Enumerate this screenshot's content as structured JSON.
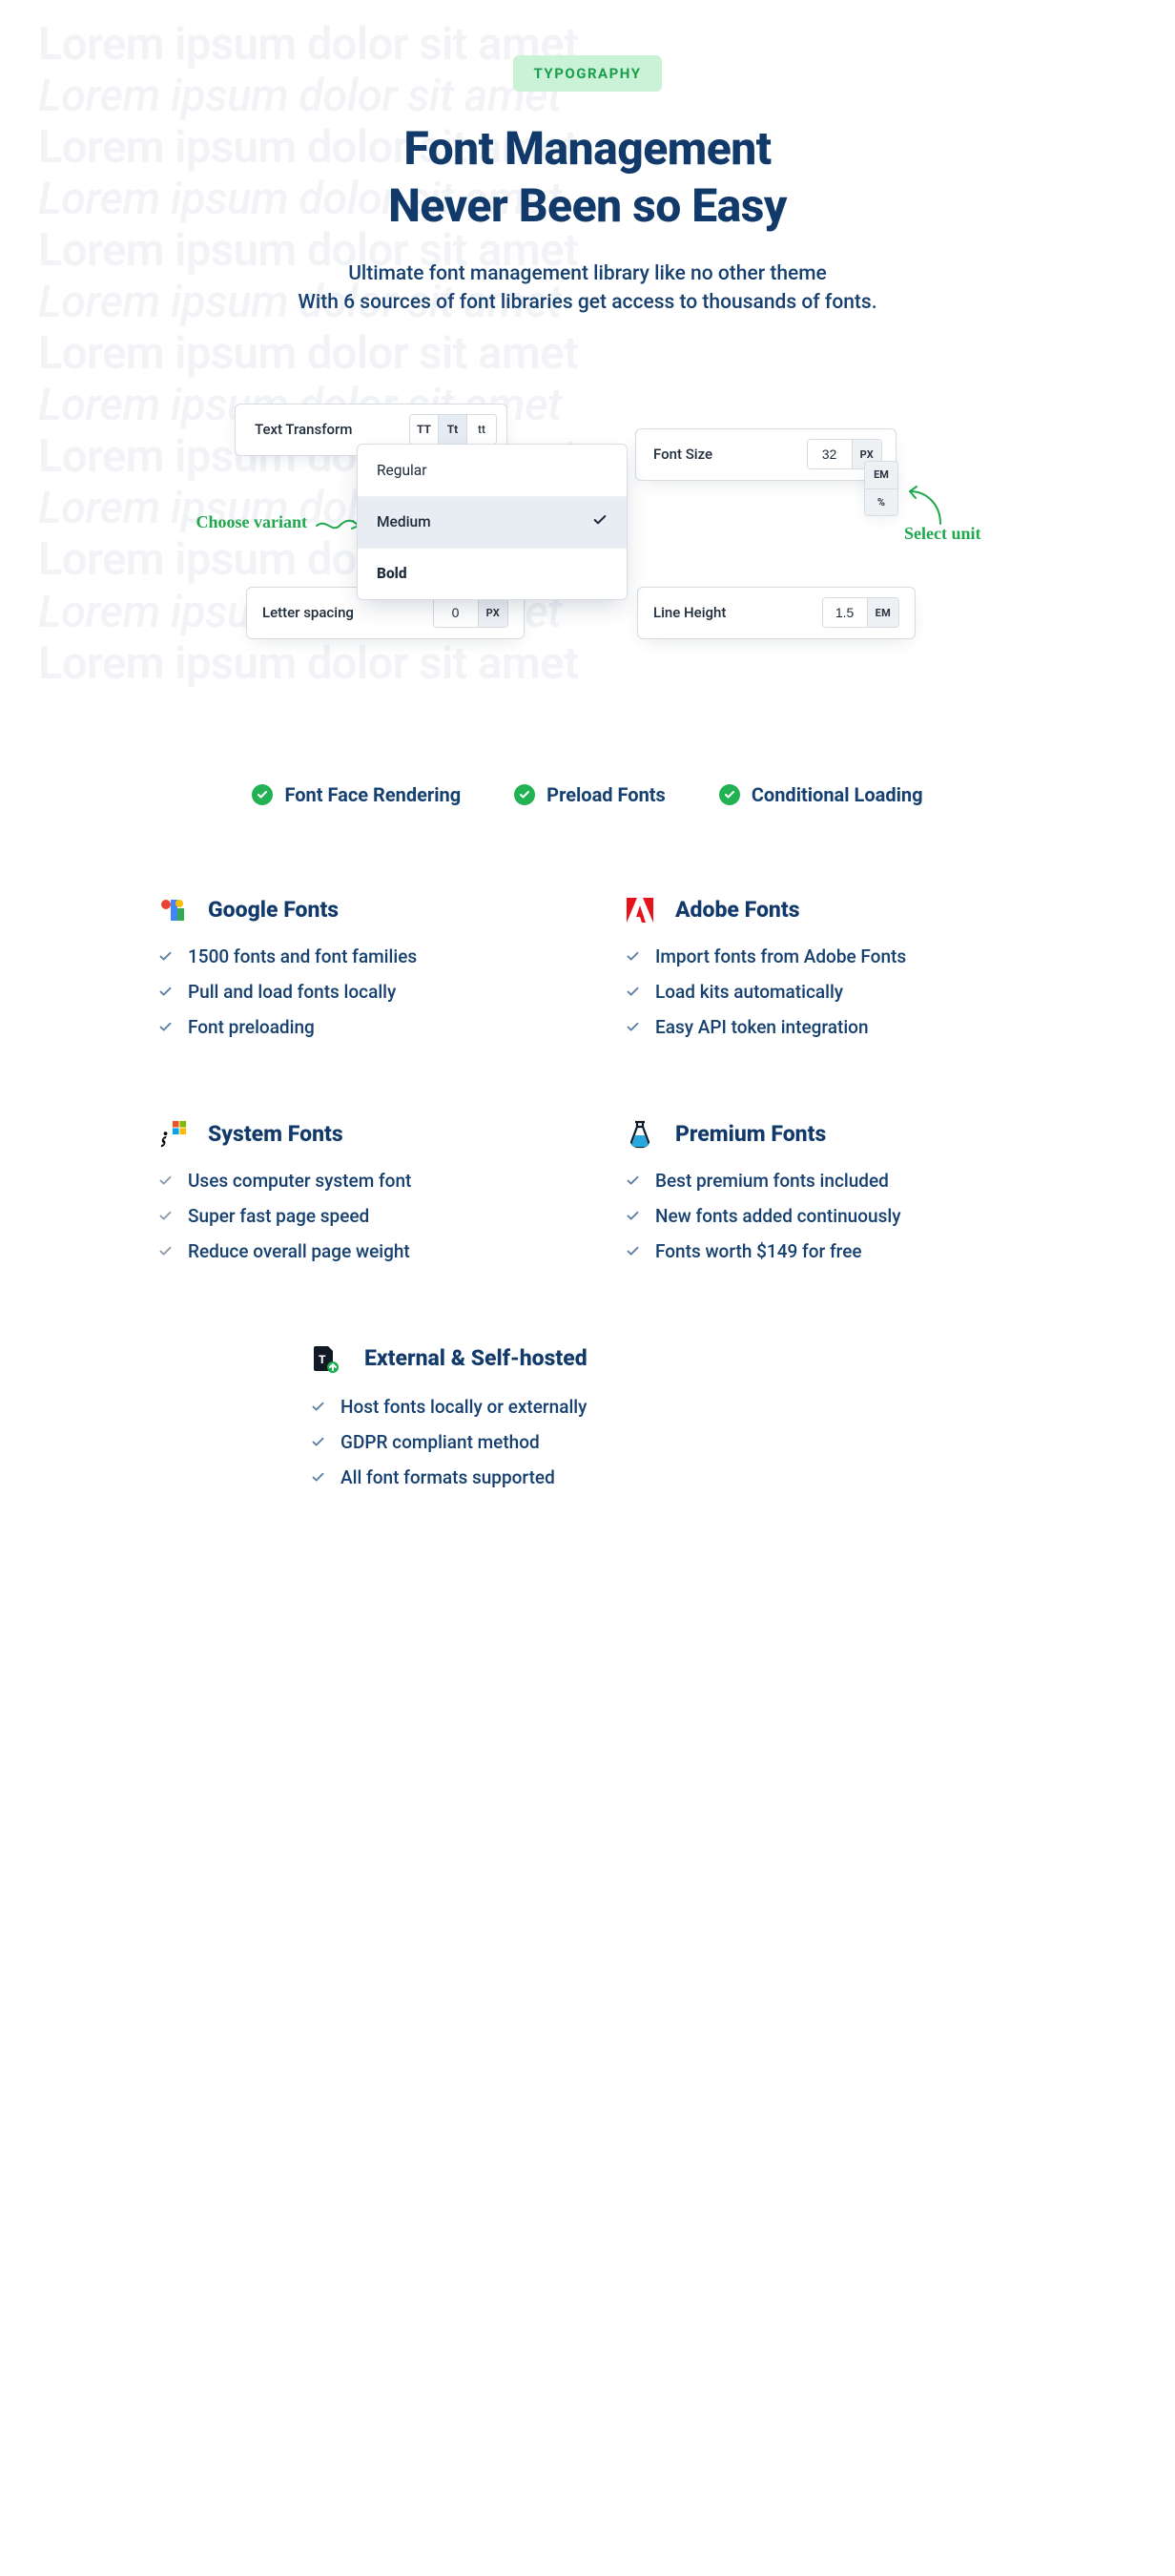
{
  "badge": "TYPOGRAPHY",
  "ghost_line": "Lorem ipsum dolor sit amet",
  "hero": {
    "title_line1": "Font Management",
    "title_line2": "Never Been so Easy",
    "sub_line1": "Ultimate font management library like no other theme",
    "sub_line2": "With 6 sources of font libraries get access to thousands of fonts."
  },
  "demo": {
    "text_transform": {
      "label": "Text Transform",
      "opts": [
        "TT",
        "Tt",
        "tt"
      ],
      "selected_index": 1
    },
    "variant": {
      "annotation": "Choose variant",
      "options": [
        "Regular",
        "Medium",
        "Bold"
      ],
      "selected": "Medium"
    },
    "font_size": {
      "label": "Font Size",
      "value": "32",
      "unit": "PX",
      "unit_options": [
        "EM",
        "%"
      ],
      "annotation": "Select unit"
    },
    "letter_spacing": {
      "label": "Letter spacing",
      "value": "0",
      "unit": "PX"
    },
    "line_height": {
      "label": "Line Height",
      "value": "1.5",
      "unit": "EM"
    }
  },
  "features_strip": [
    "Font Face Rendering",
    "Preload Fonts",
    "Conditional Loading"
  ],
  "sources": [
    {
      "icon": "google",
      "title": "Google Fonts",
      "items": [
        "1500 fonts and font families",
        "Pull and load  fonts locally",
        "Font preloading"
      ]
    },
    {
      "icon": "adobe",
      "title": "Adobe Fonts",
      "items": [
        "Import fonts from Adobe Fonts",
        "Load kits automatically",
        "Easy API token integration"
      ]
    },
    {
      "icon": "system",
      "title": "System Fonts",
      "items": [
        "Uses computer system font",
        "Super fast page speed",
        "Reduce overall page weight"
      ]
    },
    {
      "icon": "premium",
      "title": "Premium Fonts",
      "items": [
        "Best premium fonts included",
        "New fonts added continuously",
        "Fonts worth $149 for free"
      ]
    }
  ],
  "source_last": {
    "icon": "external",
    "title": "External & Self-hosted",
    "items": [
      "Host fonts locally or externally",
      "GDPR compliant method",
      "All font formats supported"
    ]
  }
}
